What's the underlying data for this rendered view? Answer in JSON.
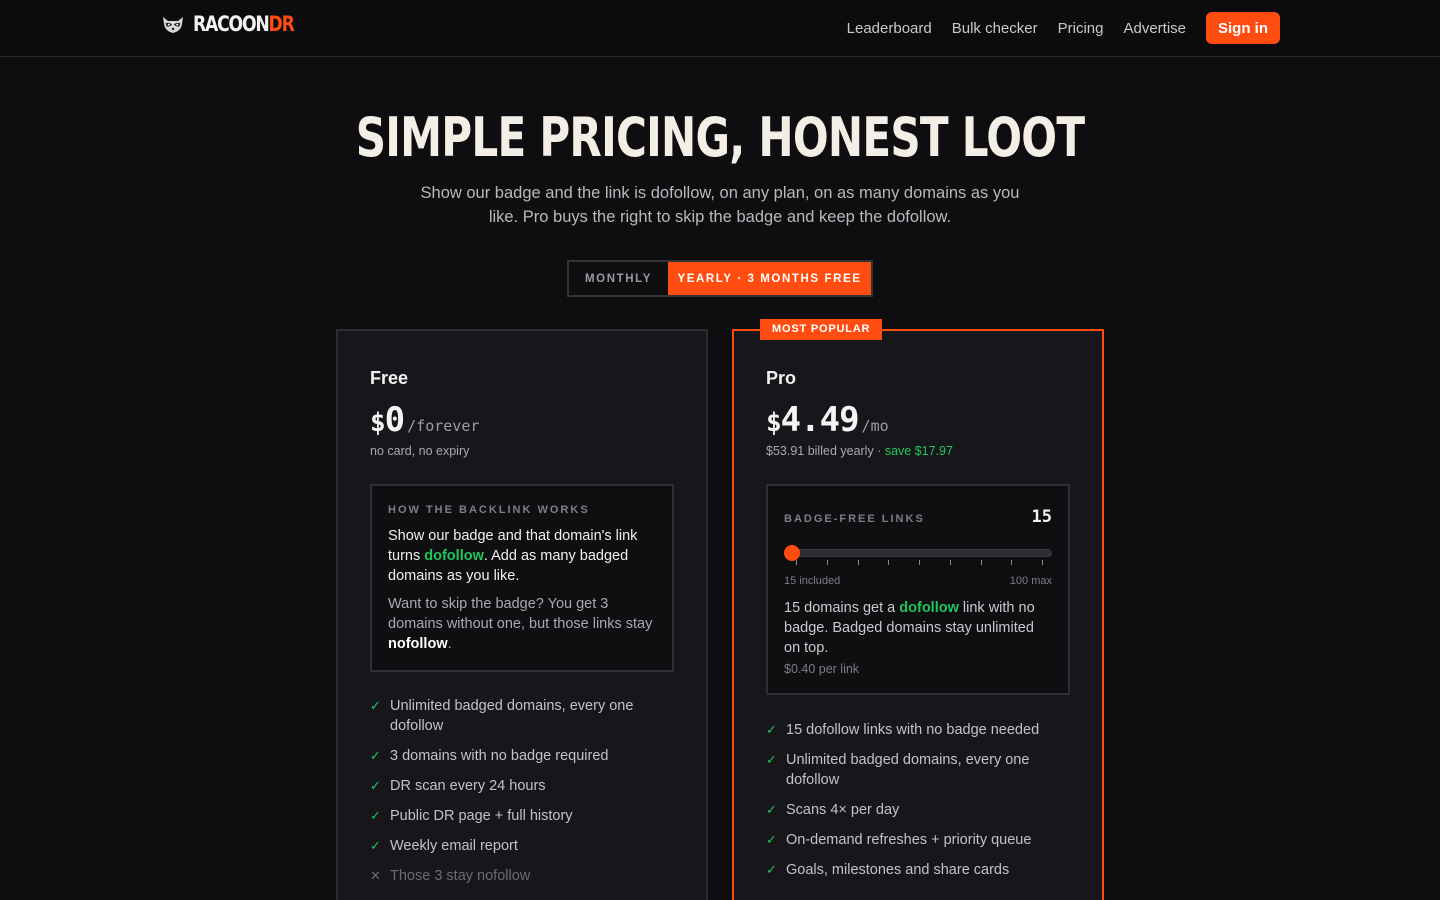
{
  "nav": {
    "brand_main": "RACOON",
    "brand_accent": "DR",
    "links": [
      "Leaderboard",
      "Bulk checker",
      "Pricing",
      "Advertise"
    ],
    "signin": "Sign in",
    "brand_icon": "raccoon-icon"
  },
  "hero": {
    "title": "SIMPLE PRICING, HONEST LOOT",
    "subtitle": "Show our badge and the link is dofollow, on any plan, on as many domains as you like. Pro buys the right to skip the badge and keep the dofollow."
  },
  "billing_toggle": {
    "monthly": "MONTHLY",
    "yearly": "YEARLY · 3 MONTHS FREE",
    "selected": "yearly"
  },
  "free": {
    "name": "Free",
    "currency": "$",
    "amount": "0",
    "suffix": "/forever",
    "note": "no card, no expiry",
    "box": {
      "eyebrow": "HOW THE BACKLINK WORKS",
      "p1_a": "Show our badge and that domain's link turns ",
      "p1_hl": "dofollow",
      "p1_b": ". Add as many badged domains as you like.",
      "p2_a": "Want to skip the badge? You get 3 domains without one, but those links stay ",
      "p2_hl": "nofollow",
      "p2_b": "."
    },
    "features": [
      {
        "text": "Unlimited badged domains, every one dofollow",
        "included": true
      },
      {
        "text": "3 domains with no badge required",
        "included": true
      },
      {
        "text": "DR scan every 24 hours",
        "included": true
      },
      {
        "text": "Public DR page + full history",
        "included": true
      },
      {
        "text": "Weekly email report",
        "included": true
      },
      {
        "text": "Those 3 stay nofollow",
        "included": false
      }
    ]
  },
  "pro": {
    "badge": "MOST POPULAR",
    "name": "Pro",
    "currency": "$",
    "amount": "4.49",
    "suffix": "/mo",
    "note": "$53.91 billed yearly",
    "note_sep": " · ",
    "save": "save $17.97",
    "slider": {
      "eyebrow": "BADGE-FREE LINKS",
      "value": "15",
      "min_label": "15 included",
      "max_label": "100 max",
      "fraction": 0,
      "desc_a": "15 domains get a ",
      "desc_hl": "dofollow",
      "desc_b": " link with no badge. Badged domains stay unlimited on top.",
      "per_link": "$0.40 per link"
    },
    "features": [
      {
        "text": "15 dofollow links with no badge needed",
        "included": true
      },
      {
        "text": "Unlimited badged domains, every one dofollow",
        "included": true
      },
      {
        "text": "Scans 4× per day",
        "included": true
      },
      {
        "text": "On-demand refreshes + priority queue",
        "included": true
      },
      {
        "text": "Goals, milestones and share cards",
        "included": true
      }
    ]
  },
  "colors": {
    "accent": "#ff4d12",
    "positive": "#21c55d",
    "background": "#0e0e10"
  }
}
